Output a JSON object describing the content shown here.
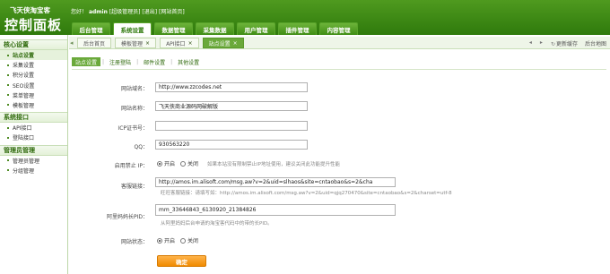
{
  "header": {
    "logo_sub": "飞天侠淘宝客",
    "logo_main": "控制面板",
    "greeting": "您好！",
    "username": "admin",
    "role": "[超级管理员]",
    "logout": "[退出]",
    "site_home": "[网站首页]"
  },
  "nav": [
    {
      "label": "后台管理",
      "active": false
    },
    {
      "label": "系统设置",
      "active": true
    },
    {
      "label": "数据管理",
      "active": false
    },
    {
      "label": "采集数据",
      "active": false
    },
    {
      "label": "用户管理",
      "active": false
    },
    {
      "label": "插件管理",
      "active": false
    },
    {
      "label": "内容管理",
      "active": false
    }
  ],
  "sidebar": {
    "sections": [
      {
        "title": "核心设置",
        "items": [
          "站点设置",
          "采集设置",
          "积分设置",
          "SEO设置",
          "菜单管理",
          "模板管理"
        ]
      },
      {
        "title": "系统接口",
        "items": [
          "API接口",
          "登陆接口"
        ]
      },
      {
        "title": "管理员管理",
        "items": [
          "管理员管理",
          "分组管理"
        ]
      }
    ],
    "active_item": "站点设置"
  },
  "tabbar": {
    "tabs": [
      {
        "label": "后台首页",
        "closable": false
      },
      {
        "label": "模板管理",
        "closable": true
      },
      {
        "label": "API接口",
        "closable": true
      },
      {
        "label": "站点设置",
        "closable": true,
        "active": true
      }
    ],
    "tools": {
      "refresh": "更新缓存",
      "sitemap": "后台地图"
    }
  },
  "subtabs": [
    "站点设置",
    "注册登陆",
    "邮件设置",
    "其他设置"
  ],
  "form": {
    "site_url": {
      "label": "网站域名：",
      "value": "http://www.zzcodes.net"
    },
    "site_name": {
      "label": "网站名称：",
      "value": "飞天侠商业源码网破解版"
    },
    "icp": {
      "label": "ICP证书号：",
      "value": ""
    },
    "qq": {
      "label": "QQ：",
      "value": "930563220"
    },
    "ip_block": {
      "label": "启用禁止 IP：",
      "options": [
        "开启",
        "关闭"
      ],
      "selected": "开启",
      "hint": "如果本站没有限制禁止IP地址使用，建议关闭此功能提升性能"
    },
    "customer_service": {
      "label": "客服链接：",
      "value": "http://amos.im.alisoft.com/msg.aw?v=2&uid=slhaos&site=cntaobao&s=2&cha",
      "hint": "旺旺客服链接：请填写如：http://amos.im.alisoft.com/msg.aw?v=2&uid=qjq270470&site=cntaobao&s=2&charset=utf-8"
    },
    "pid": {
      "label": "阿里妈妈长PID：",
      "value": "mm_33646843_6130920_21384826",
      "hint": "从阿里妈妈后台申请的淘宝客代码中的带的长PID。"
    },
    "site_status": {
      "label": "网站状态：",
      "options": [
        "开启",
        "关闭"
      ],
      "selected": "开启"
    },
    "submit": "确定"
  }
}
